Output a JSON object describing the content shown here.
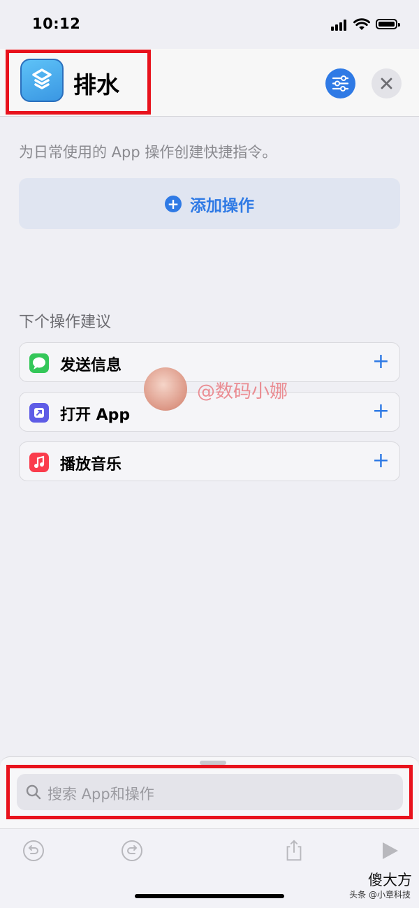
{
  "status_bar": {
    "time": "10:12"
  },
  "header": {
    "title": "排水"
  },
  "main": {
    "description": "为日常使用的 App 操作创建快捷指令。",
    "add_action_label": "添加操作",
    "suggestions_title": "下个操作建议",
    "suggestions": [
      {
        "label": "发送信息",
        "icon": "messages-icon",
        "color": "#34c759"
      },
      {
        "label": "打开 App",
        "icon": "open-app-icon",
        "color": "#5e5ce6"
      },
      {
        "label": "播放音乐",
        "icon": "music-icon",
        "color": "#fa3c4c"
      }
    ]
  },
  "watermark": {
    "text": "@数码小娜"
  },
  "search": {
    "placeholder": "搜索 App和操作"
  },
  "corner_watermark": {
    "main": "傻大方",
    "sub": "头条 @小章科技"
  },
  "colors": {
    "accent": "#2f7ae5",
    "highlight_box": "#e8121c"
  }
}
